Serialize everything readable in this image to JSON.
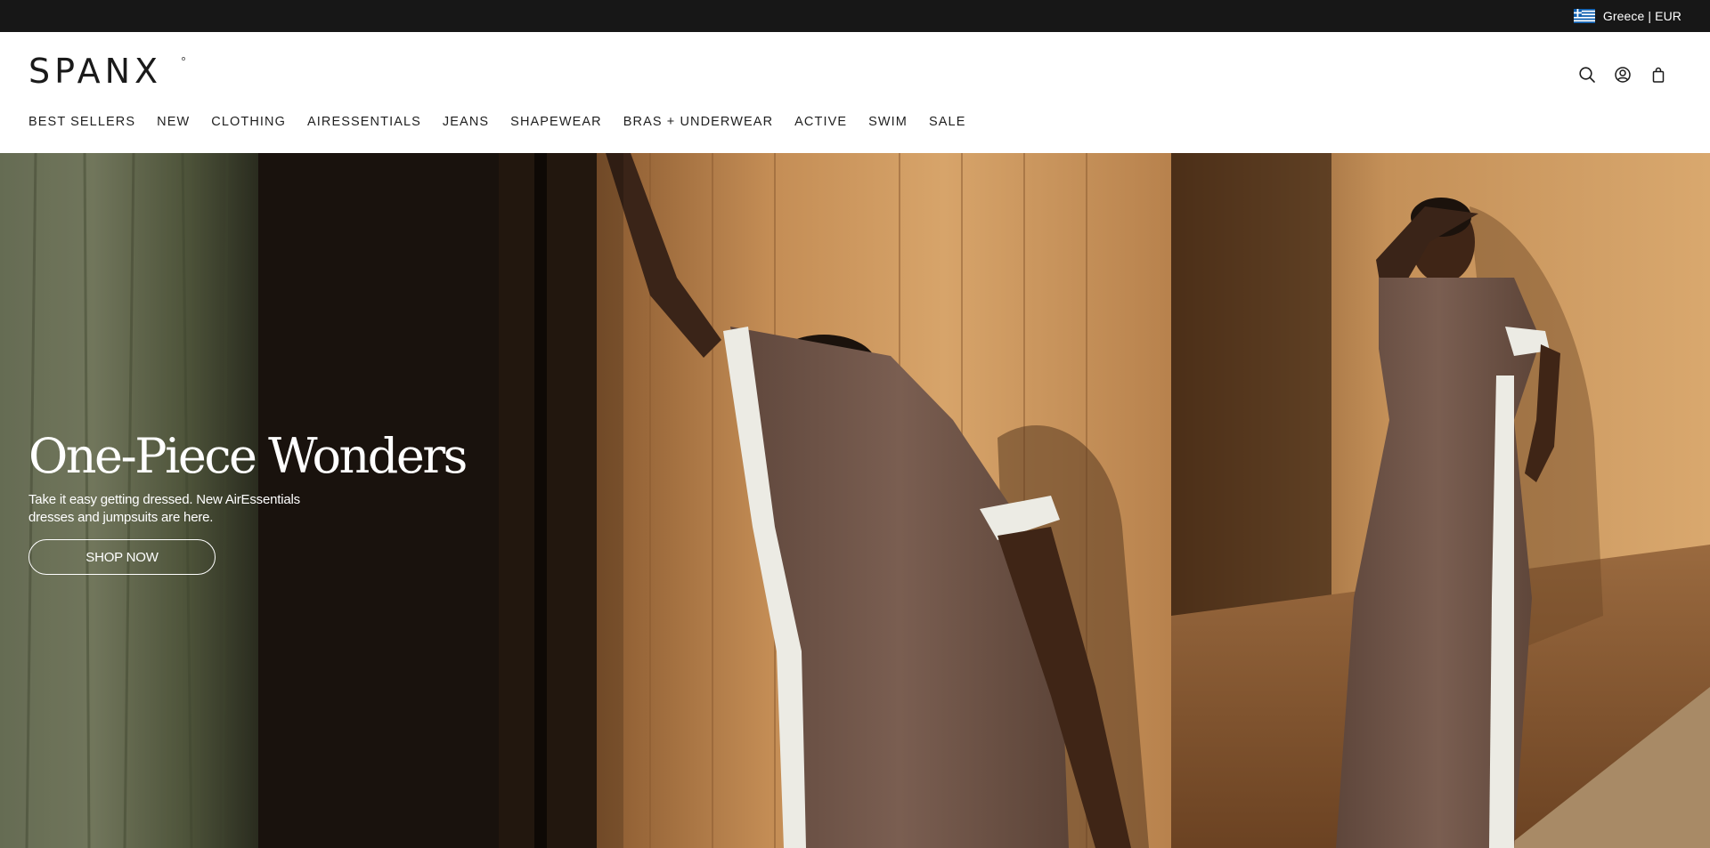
{
  "topbar": {
    "locale_label": "Greece | EUR",
    "flag_icon": "greece-flag-icon",
    "background": "#171717"
  },
  "header": {
    "logo_text": "SPANX",
    "icons": [
      "search-icon",
      "account-icon",
      "cart-icon"
    ]
  },
  "nav": {
    "items": [
      {
        "label": "BEST SELLERS"
      },
      {
        "label": "NEW"
      },
      {
        "label": "CLOTHING"
      },
      {
        "label": "AIRESSENTIALS"
      },
      {
        "label": "JEANS"
      },
      {
        "label": "SHAPEWEAR"
      },
      {
        "label": "BRAS + UNDERWEAR"
      },
      {
        "label": "ACTIVE"
      },
      {
        "label": "SWIM"
      },
      {
        "label": "SALE"
      }
    ]
  },
  "hero": {
    "title": "One-Piece Wonders",
    "subtitle": "Take it easy getting dressed. New AirEssentials dresses and jumpsuits are here.",
    "cta_label": "SHOP NOW",
    "image": "two-models-in-brown-jumpsuits-photo"
  },
  "colors": {
    "jumpsuit": "#6e5448",
    "wood": "#b08050",
    "curtain": "#6d7556"
  }
}
